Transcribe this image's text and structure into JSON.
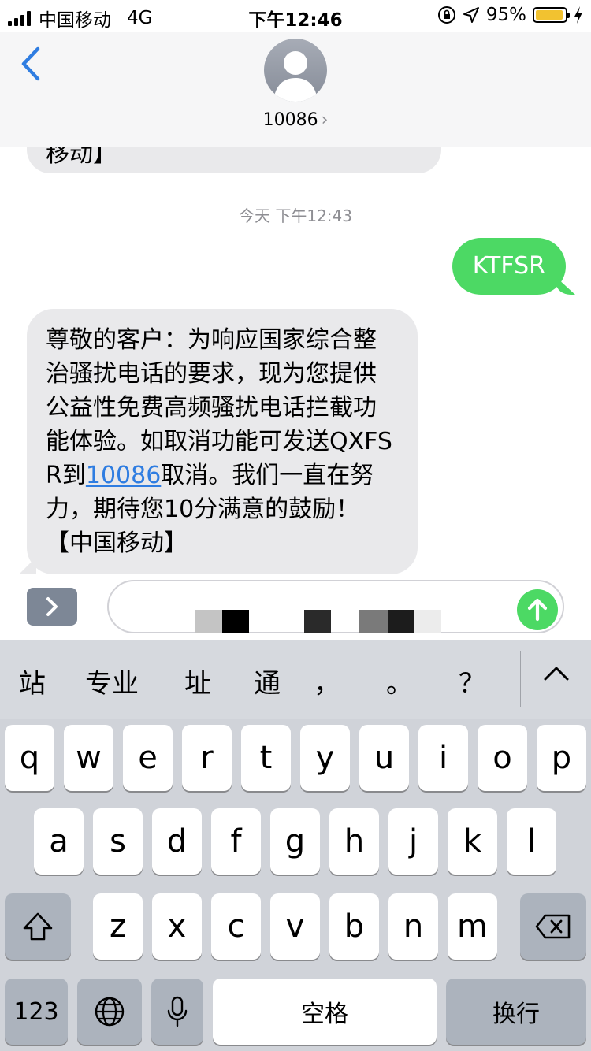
{
  "status_bar": {
    "carrier": "中国移动",
    "network": "4G",
    "time": "下午12:46",
    "battery_percent": "95%",
    "battery_level": 0.95,
    "icons": [
      "signal-icon",
      "orientation-lock-icon",
      "location-icon",
      "battery-icon",
      "charging-icon"
    ]
  },
  "header": {
    "back_icon": "chevron-left-icon",
    "avatar_icon": "person-silhouette-icon",
    "contact": "10086",
    "contact_chevron": "›"
  },
  "messages": {
    "previous_fragment": "移动】",
    "timestamp": "今天 下午12:43",
    "outgoing": "KTFSR",
    "incoming": {
      "before_link": "尊敬的客户：为响应国家综合整治骚扰电话的要求，现为您提供公益性免费高频骚扰电话拦截功能体验。如取消功能可发送QXFSR到",
      "link": "10086",
      "after_link": "取消。我们一直在努力，期待您10分满意的鼓励！【中国移动】"
    },
    "bubble_colors": {
      "outgoing": "#4cd964",
      "incoming": "#e9e9eb",
      "link": "#2f7de1"
    }
  },
  "composer": {
    "expand_icon": "chevron-right-icon",
    "send_icon": "arrow-up-icon"
  },
  "keyboard": {
    "candidates": [
      "站",
      "专业",
      "址",
      "通",
      "，",
      "。",
      "？"
    ],
    "collapse_icon": "chevron-up-icon",
    "row1": [
      "q",
      "w",
      "e",
      "r",
      "t",
      "y",
      "u",
      "i",
      "o",
      "p"
    ],
    "row2": [
      "a",
      "s",
      "d",
      "f",
      "g",
      "h",
      "j",
      "k",
      "l"
    ],
    "row3": [
      "z",
      "x",
      "c",
      "v",
      "b",
      "n",
      "m"
    ],
    "shift_icon": "shift-icon",
    "delete_icon": "delete-backspace-icon",
    "numbers_label": "123",
    "globe_icon": "globe-icon",
    "mic_icon": "microphone-icon",
    "space_label": "空格",
    "return_label": "换行"
  }
}
